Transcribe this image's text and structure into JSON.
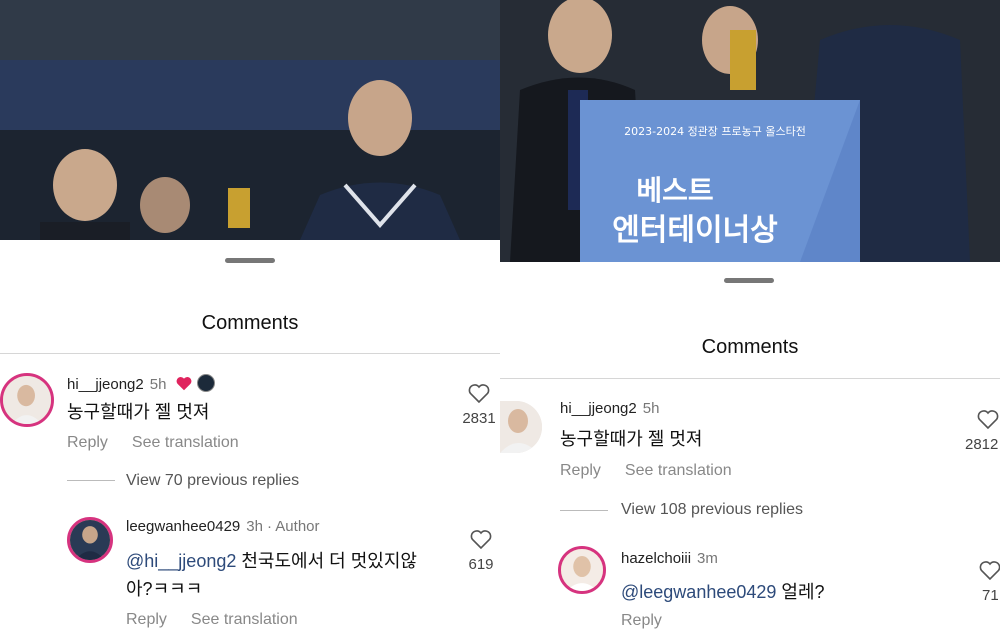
{
  "left": {
    "sheet_title": "Comments",
    "comment1": {
      "username": "hi__jjeong2",
      "time": "5h",
      "text": "농구할때가 젤 멋져",
      "reply": "Reply",
      "see_translation": "See translation",
      "likes": "2831"
    },
    "view_previous": "View 70 previous replies",
    "comment2": {
      "username": "leegwanhee0429",
      "time": "3h",
      "author_badge": "· Author",
      "mention": "@hi__jjeong2",
      "text_line1": " 천국도에서 더 멋있지않",
      "text_line2": "아?ㅋㅋㅋ",
      "reply": "Reply",
      "see_translation": "See translation",
      "likes": "619"
    }
  },
  "right": {
    "sheet_title": "Comments",
    "banner_line1": "2023-2024 정관장 프로농구 올스타전",
    "banner_line2": "베스트",
    "banner_line3": "엔터테이너상",
    "comment1": {
      "username": "hi__jjeong2",
      "time": "5h",
      "text": "농구할때가 젤 멋져",
      "reply": "Reply",
      "see_translation": "See translation",
      "likes": "2812"
    },
    "view_previous": "View 108 previous replies",
    "comment2": {
      "username": "hazelchoiii",
      "time": "3m",
      "mention": "@leegwanhee0429",
      "text": " 얼레?",
      "reply": "Reply",
      "likes": "71"
    }
  },
  "colors": {
    "mention": "#2d4a7a",
    "like_red": "#e0245e",
    "story_ring": "#d6337f"
  },
  "icons": [
    "heart-outline-icon",
    "red-heart-icon",
    "drag-handle-icon"
  ]
}
